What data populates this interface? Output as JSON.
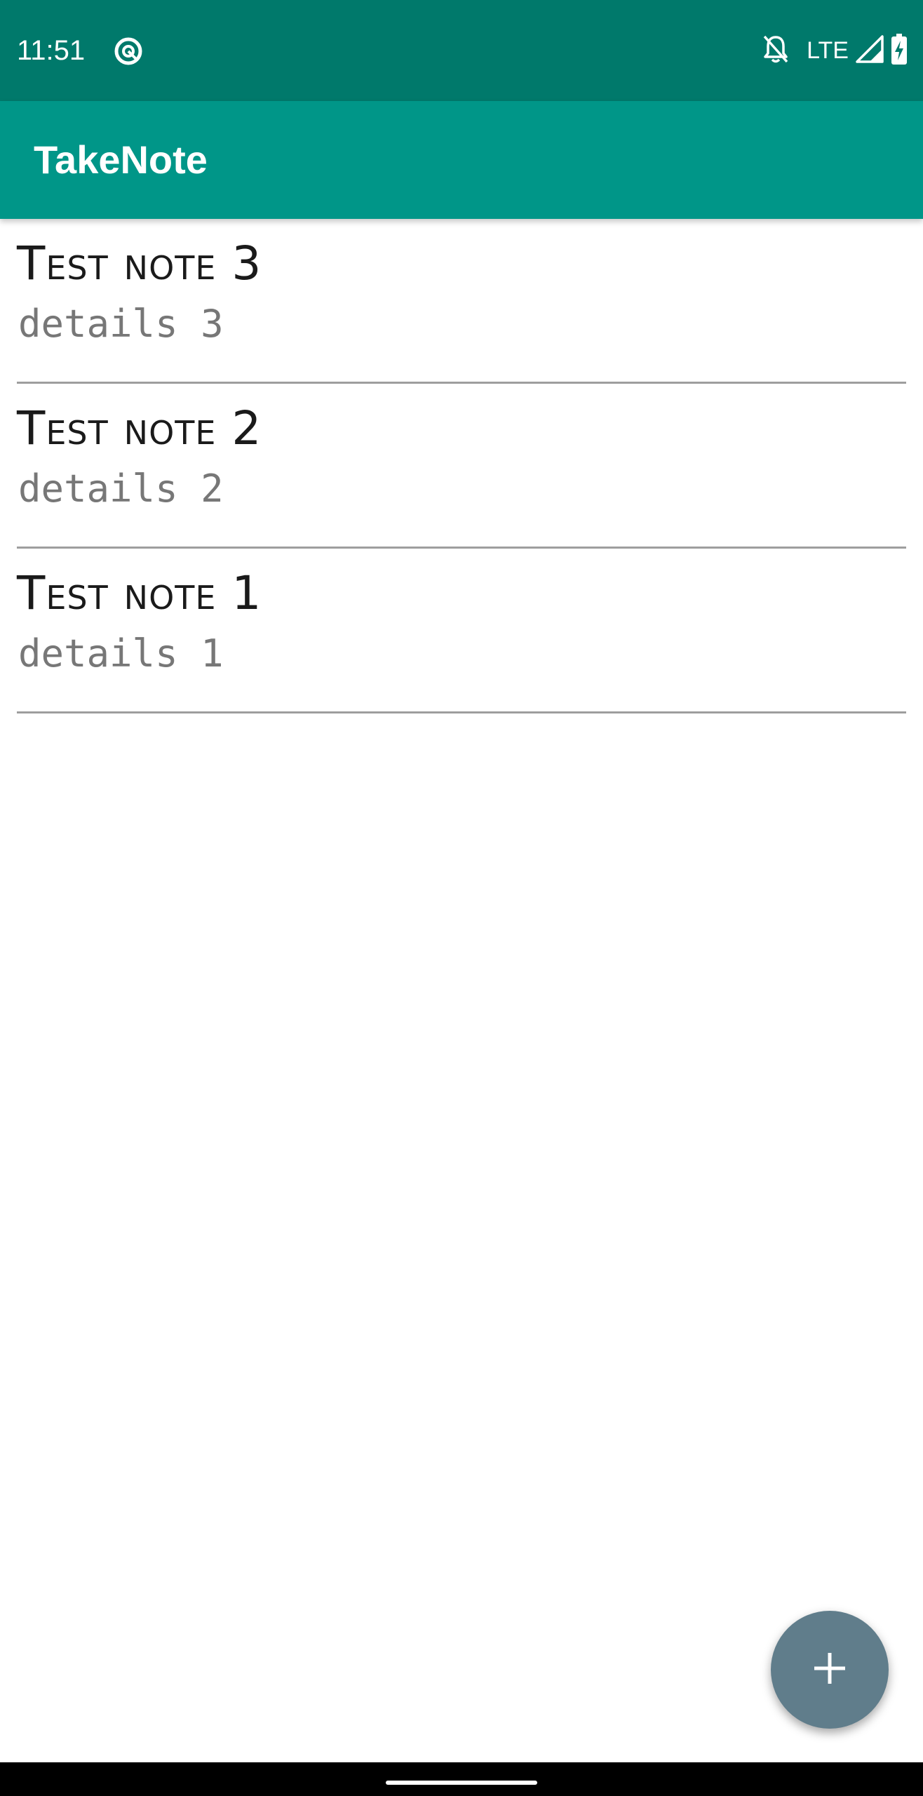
{
  "status_bar": {
    "time": "11:51",
    "network": "LTE",
    "icons": [
      "data-saver-icon",
      "notifications-off-icon",
      "signal-icon",
      "battery-charging-icon"
    ]
  },
  "app_bar": {
    "title": "TakeNote"
  },
  "notes": [
    {
      "title": "Test note 3",
      "details": "details 3"
    },
    {
      "title": "Test note 2",
      "details": "details 2"
    },
    {
      "title": "Test note 1",
      "details": "details 1"
    }
  ],
  "fab": {
    "icon": "add-icon"
  },
  "colors": {
    "status_bar": "#00796b",
    "app_bar": "#009688",
    "fab": "#607d8b",
    "divider": "#9e9e9e",
    "details_text": "#777777"
  }
}
